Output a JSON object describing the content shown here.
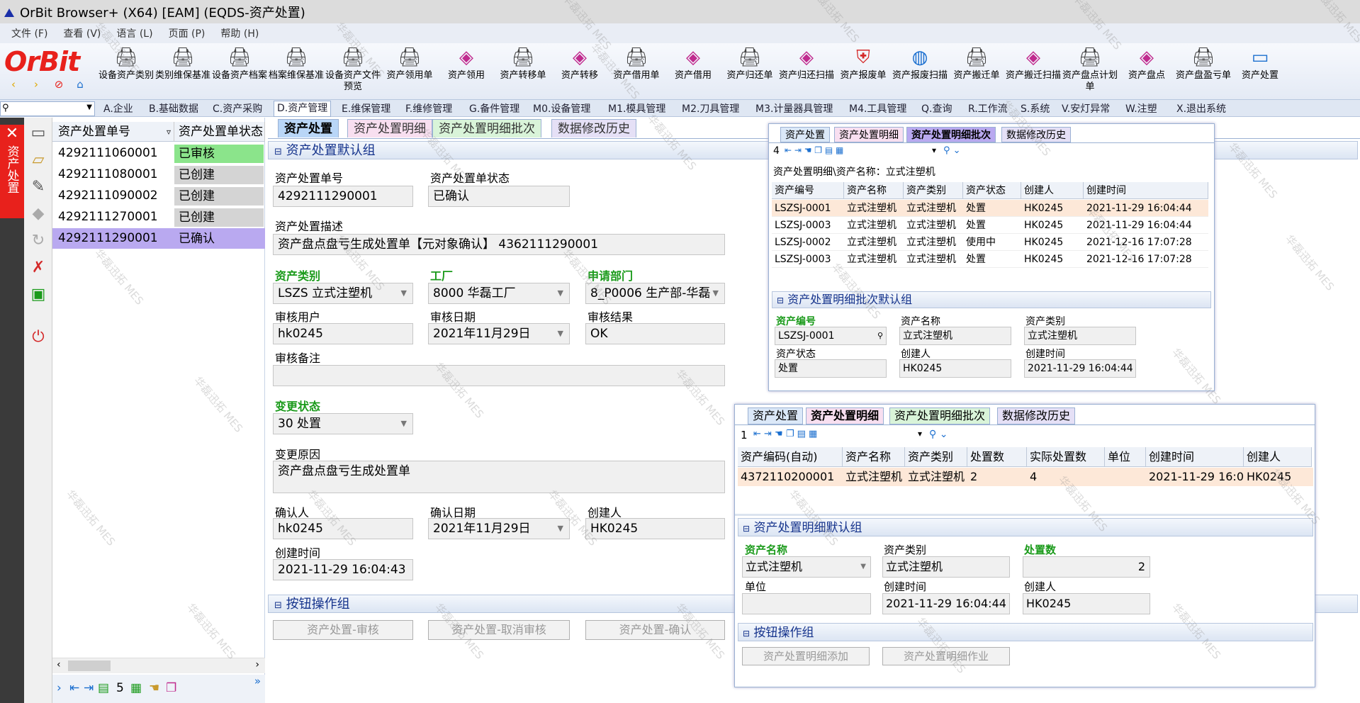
{
  "app": {
    "title": "OrBit Browser+ (X64) [EAM] (EQDS-资产处置)",
    "logo_text": "OrBit"
  },
  "menu": [
    "文件 (F)",
    "查看 (V)",
    "语言 (L)",
    "页面 (P)",
    "帮助 (H)"
  ],
  "toolbar": [
    {
      "label": "设备资产类别",
      "icon": "printer-icon"
    },
    {
      "label": "类别维保基准",
      "icon": "printer-icon"
    },
    {
      "label": "设备资产档案",
      "icon": "printer-icon"
    },
    {
      "label": "档案维保基准",
      "icon": "printer-icon"
    },
    {
      "label": "设备资产文件预览",
      "icon": "printer-icon"
    },
    {
      "label": "资产领用单",
      "icon": "printer-icon"
    },
    {
      "label": "资产领用",
      "icon": "cube-icon"
    },
    {
      "label": "资产转移单",
      "icon": "printer-icon"
    },
    {
      "label": "资产转移",
      "icon": "cube-icon"
    },
    {
      "label": "资产借用单",
      "icon": "printer-icon"
    },
    {
      "label": "资产借用",
      "icon": "cube-icon"
    },
    {
      "label": "资产归还单",
      "icon": "printer-icon"
    },
    {
      "label": "资产归还扫描",
      "icon": "cube-icon"
    },
    {
      "label": "资产报废单",
      "icon": "shield-icon"
    },
    {
      "label": "资产报废扫描",
      "icon": "globe-icon"
    },
    {
      "label": "资产搬迁单",
      "icon": "printer-icon"
    },
    {
      "label": "资产搬迁扫描",
      "icon": "cube-icon"
    },
    {
      "label": "资产盘点计划单",
      "icon": "printer-icon"
    },
    {
      "label": "资产盘点",
      "icon": "cube-icon"
    },
    {
      "label": "资产盘盈亏单",
      "icon": "printer-icon"
    },
    {
      "label": "资产处置",
      "icon": "monitor-icon"
    }
  ],
  "nav": [
    "A.企业",
    "B.基础数据",
    "C.资产采购",
    "D.资产管理",
    "E.维保管理",
    "F.维修管理",
    "G.备件管理",
    "M0.设备管理",
    "M1.模具管理",
    "M2.刀具管理",
    "M3.计量器具管理",
    "M4.工具管理",
    "Q.查询",
    "R.工作流",
    "S.系统",
    "V.安灯异常",
    "W.注塑",
    "X.退出系统"
  ],
  "nav_active": "D.资产管理",
  "sidebar": {
    "active_label": "资产处置"
  },
  "list": {
    "headers": [
      "资产处置单号",
      "资产处置单状态"
    ],
    "rows": [
      {
        "no": "4292111060001",
        "status": "已审核"
      },
      {
        "no": "4292111080001",
        "status": "已创建"
      },
      {
        "no": "4292111090002",
        "status": "已创建"
      },
      {
        "no": "4292111270001",
        "status": "已创建"
      },
      {
        "no": "4292111290001",
        "status": "已确认"
      }
    ],
    "count": "5"
  },
  "main_tabs": [
    "资产处置",
    "资产处置明细",
    "资产处置明细批次",
    "数据修改历史"
  ],
  "form": {
    "section": "资产处置默认组",
    "no_label": "资产处置单号",
    "no": "4292111290001",
    "status_label": "资产处置单状态",
    "status": "已确认",
    "desc_label": "资产处置描述",
    "desc": "资产盘点盘亏生成处置单【元对象确认】 4362111290001",
    "type_label": "资产类别",
    "type": "LSZS 立式注塑机",
    "factory_label": "工厂",
    "factory": "8000 华磊工厂",
    "dept_label": "申请部门",
    "dept": "8_P0006 生产部-华磊",
    "audit_user_label": "审核用户",
    "audit_user": "hk0245",
    "audit_date_label": "审核日期",
    "audit_date": "2021年11月29日",
    "audit_result_label": "审核结果",
    "audit_result": "OK",
    "audit_note_label": "审核备注",
    "audit_note": "",
    "change_state_label": "变更状态",
    "change_state": "30 处置",
    "change_reason_label": "变更原因",
    "change_reason": "资产盘点盘亏生成处置单",
    "confirm_user_label": "确认人",
    "confirm_user": "hk0245",
    "confirm_date_label": "确认日期",
    "confirm_date": "2021年11月29日",
    "creator_label": "创建人",
    "creator": "HK0245",
    "created_label": "创建时间",
    "created": "2021-11-29 16:04:43"
  },
  "buttons": {
    "section": "按钮操作组",
    "audit": "资产处置-审核",
    "unaudit": "资产处置-取消审核",
    "confirm": "资产处置-确认"
  },
  "batch_panel": {
    "tabs": [
      "资产处置",
      "资产处置明细",
      "资产处置明细批次",
      "数据修改历史"
    ],
    "page": "4",
    "caption": "资产处置明细\\资产名称：立式注塑机",
    "headers": [
      "资产编号",
      "资产名称",
      "资产类别",
      "资产状态",
      "创建人",
      "创建时间"
    ],
    "rows": [
      [
        "LSZSJ-0001",
        "立式注塑机",
        "立式注塑机",
        "处置",
        "HK0245",
        "2021-11-29 16:04:44"
      ],
      [
        "LSZSJ-0003",
        "立式注塑机",
        "立式注塑机",
        "处置",
        "HK0245",
        "2021-11-29 16:04:44"
      ],
      [
        "LSZSJ-0002",
        "立式注塑机",
        "立式注塑机",
        "使用中",
        "HK0245",
        "2021-12-16 17:07:28"
      ],
      [
        "LSZSJ-0003",
        "立式注塑机",
        "立式注塑机",
        "处置",
        "HK0245",
        "2021-12-16 17:07:28"
      ]
    ],
    "section": "资产处置明细批次默认组",
    "f_no_label": "资产编号",
    "f_no": "LSZSJ-0001",
    "f_name_label": "资产名称",
    "f_name": "立式注塑机",
    "f_type_label": "资产类别",
    "f_type": "立式注塑机",
    "f_state_label": "资产状态",
    "f_state": "处置",
    "f_creator_label": "创建人",
    "f_creator": "HK0245",
    "f_created_label": "创建时间",
    "f_created": "2021-11-29 16:04:44"
  },
  "detail_panel": {
    "tabs": [
      "资产处置",
      "资产处置明细",
      "资产处置明细批次",
      "数据修改历史"
    ],
    "page": "1",
    "headers": [
      "资产编码(自动)",
      "资产名称",
      "资产类别",
      "处置数",
      "实际处置数",
      "单位",
      "创建时间",
      "创建人"
    ],
    "row": [
      "4372110200001",
      "立式注塑机",
      "立式注塑机",
      "2",
      "4",
      "",
      "2021-11-29 16:0...",
      "HK0245"
    ],
    "section": "资产处置明细默认组",
    "f_name_label": "资产名称",
    "f_name": "立式注塑机",
    "f_type_label": "资产类别",
    "f_type": "立式注塑机",
    "f_qty_label": "处置数",
    "f_qty": "2",
    "f_unit_label": "单位",
    "f_unit": "",
    "f_created_label": "创建时间",
    "f_created": "2021-11-29 16:04:44",
    "f_creator_label": "创建人",
    "f_creator": "HK0245",
    "btn_section": "按钮操作组",
    "btn_add": "资产处置明细添加",
    "btn_op": "资产处置明细作业"
  },
  "watermark": "华磊迅拓 MES",
  "colors": {
    "approved": "#8be48b",
    "created": "#d4d4d4",
    "selected": "#b9a9f0",
    "accent_red": "#e8211c",
    "label_green": "#1a9a1a"
  }
}
